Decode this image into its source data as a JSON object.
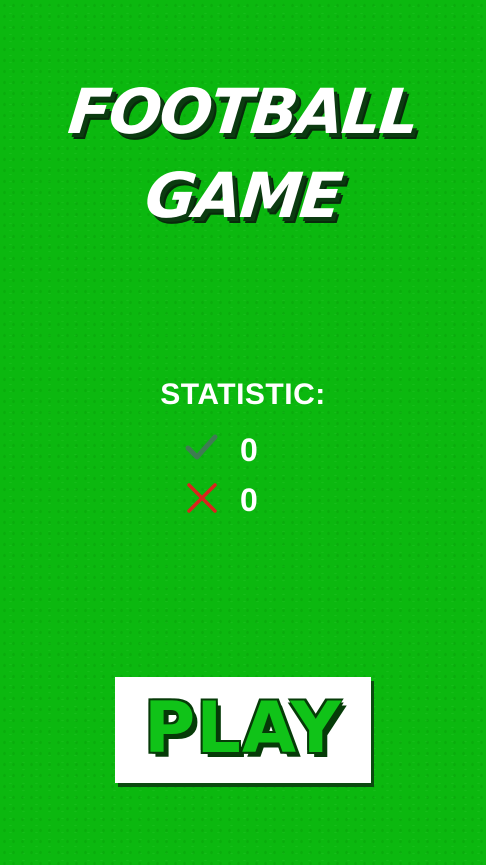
{
  "title": {
    "line1": "FOOTBALL",
    "line2": "GAME"
  },
  "statistic": {
    "heading": "STATISTIC:",
    "wins": {
      "icon": "checkmark-icon",
      "value": "0"
    },
    "losses": {
      "icon": "cross-icon",
      "value": "0"
    }
  },
  "play_button": {
    "label": "PLAY"
  },
  "colors": {
    "background": "#0bb80f",
    "play_text": "#10c318",
    "check": "#3e7d52",
    "cross": "#d9251d"
  }
}
